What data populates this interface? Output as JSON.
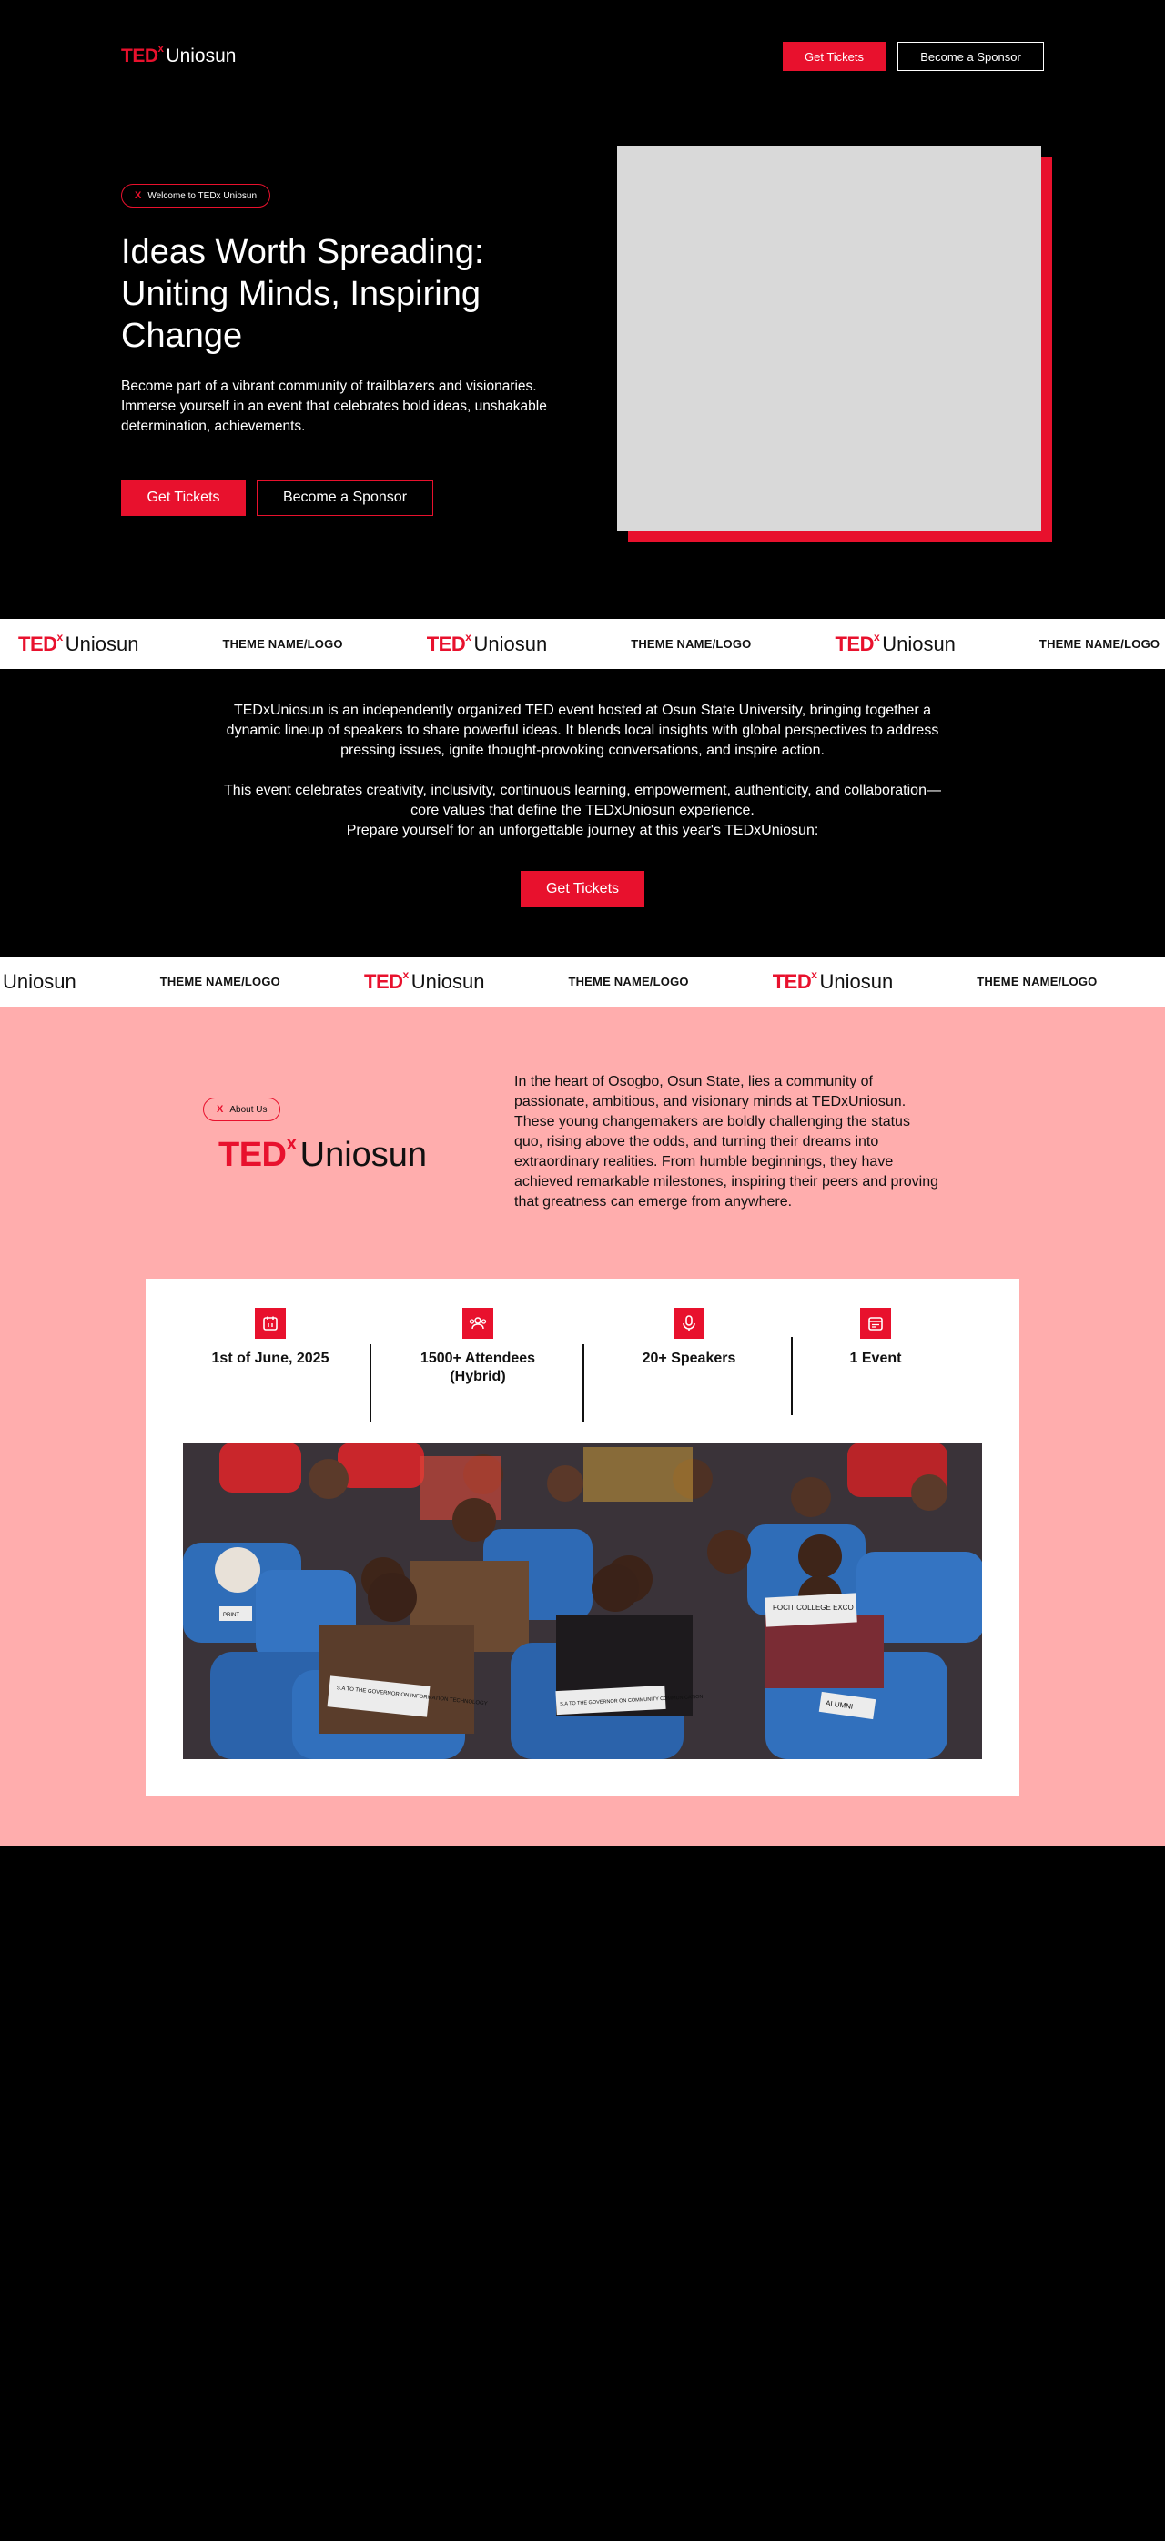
{
  "brand": {
    "ted": "TED",
    "x": "x",
    "name": "Uniosun"
  },
  "header": {
    "get_tickets": "Get Tickets",
    "become_sponsor": "Become a Sponsor"
  },
  "hero": {
    "pill_x": "X",
    "pill_text": "Welcome to TEDx Uniosun",
    "title": "Ideas Worth Spreading: Uniting Minds, Inspiring Change",
    "text": "Become part of a vibrant community of trailblazers and visionaries. Immerse yourself in an event that celebrates bold ideas, unshakable determination, achievements.",
    "get_tickets": "Get Tickets",
    "become_sponsor": "Become a Sponsor"
  },
  "marquee": {
    "theme_label": "THEME NAME/LOGO",
    "partial_name": "Uniosun"
  },
  "intro": {
    "paragraph1": "TEDxUniosun is an independently organized TED event hosted at Osun State University, bringing together a dynamic lineup of speakers to share powerful ideas. It blends local insights with global perspectives to address pressing issues, ignite thought-provoking conversations, and inspire action.",
    "paragraph2": "This event celebrates creativity, inclusivity, continuous learning, empowerment, authenticity, and collaboration—core values that define the TEDxUniosun experience.",
    "paragraph3": "Prepare yourself for an unforgettable journey at this year's TEDxUniosun:",
    "get_tickets": "Get Tickets"
  },
  "about": {
    "pill_x": "X",
    "pill_text": "About Us",
    "text": "In the heart of Osogbo, Osun State, lies a community of passionate, ambitious, and visionary minds at TEDxUniosun. These young changemakers are boldly challenging the status quo, rising above the odds, and turning their dreams into extraordinary realities. From humble beginnings, they have achieved remarkable milestones, inspiring their peers and proving that greatness can emerge from anywhere.",
    "stats": [
      {
        "icon": "calendar-icon",
        "label": "1st of June, 2025"
      },
      {
        "icon": "people-icon",
        "label": "1500+ Attendees (Hybrid)"
      },
      {
        "icon": "microphone-icon",
        "label": "20+ Speakers"
      },
      {
        "icon": "event-icon",
        "label": "1 Event"
      }
    ],
    "photo_signs": [
      "FOCIT COLLEGE EXCO",
      "S.A TO THE GOVERNOR ON INFORMATION TECHNOLOGY",
      "S.A TO THE GOVERNOR ON COMMUNITY COMMUNICATION",
      "ALUMNI",
      "PRINT"
    ]
  },
  "colors": {
    "accent": "#e8112d",
    "about_bg": "#ffadad",
    "page_bg": "#000000"
  }
}
